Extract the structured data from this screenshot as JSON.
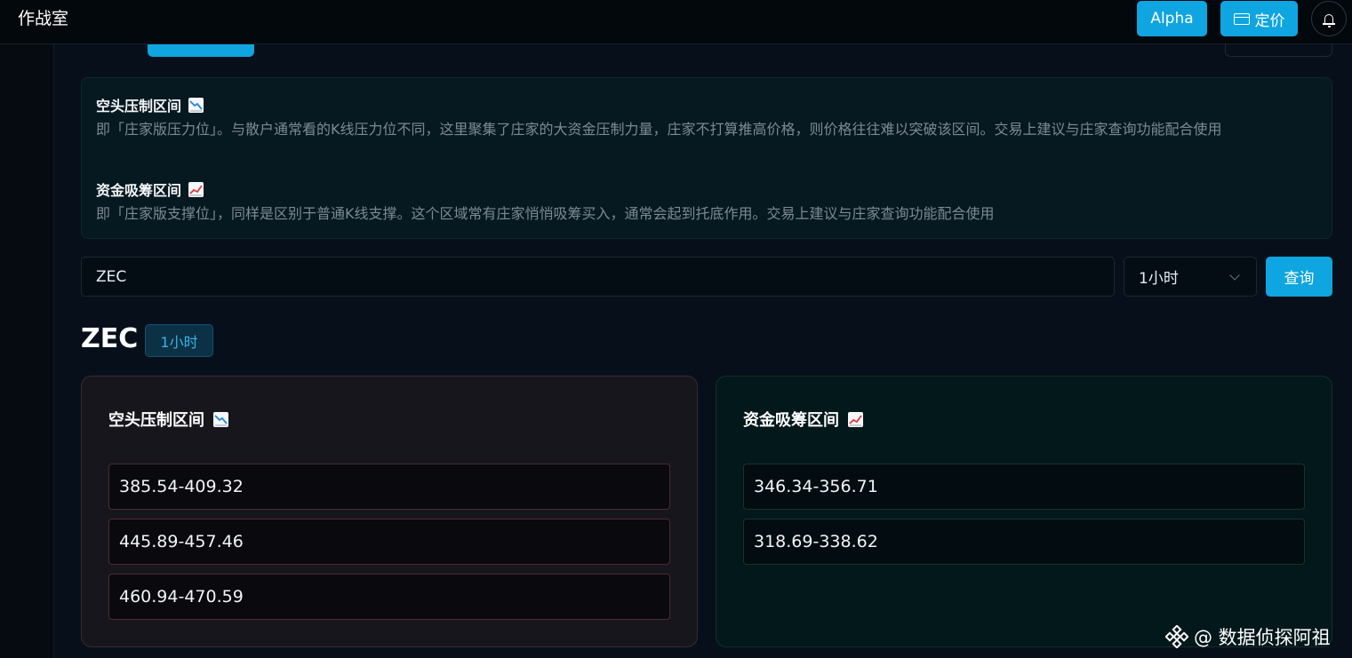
{
  "header": {
    "app_title": "作战室",
    "alpha_label": "Alpha",
    "pricing_label": "定价"
  },
  "info": {
    "short_title": "空头压制区间",
    "short_desc": "即「庄家版压力位」。与散户通常看的K线压力位不同，这里聚集了庄家的大资金压制力量，庄家不打算推高价格，则价格往往难以突破该区间。交易上建议与庄家查询功能配合使用",
    "long_title": "资金吸筹区间",
    "long_desc": "即「庄家版支撑位」，同样是区别于普通K线支撑。这个区域常有庄家悄悄吸筹买入，通常会起到托底作用。交易上建议与庄家查询功能配合使用"
  },
  "search": {
    "value": "ZEC",
    "timeframe": "1小时",
    "query_label": "查询"
  },
  "result": {
    "symbol": "ZEC",
    "timeframe": "1小时",
    "short_zone": {
      "title": "空头压制区间",
      "ranges": [
        "385.54-409.32",
        "445.89-457.46",
        "460.94-470.59"
      ]
    },
    "long_zone": {
      "title": "资金吸筹区间",
      "ranges": [
        "346.34-356.71",
        "318.69-338.62"
      ]
    }
  },
  "watermark": {
    "text": "@ 数据侦探阿祖"
  },
  "icons": {
    "short": "chart-decreasing-icon",
    "long": "chart-increasing-icon",
    "pricing": "credit-card-icon",
    "notifications": "bell-icon",
    "select": "chevron-down-icon",
    "watermark": "binance-logo-icon"
  },
  "colors": {
    "accent": "#0ea5e0",
    "background": "#07101a",
    "short_panel": "#17161d",
    "long_panel": "#03181b",
    "decreasing_line": "#1e88e5",
    "increasing_line": "#e53935"
  }
}
